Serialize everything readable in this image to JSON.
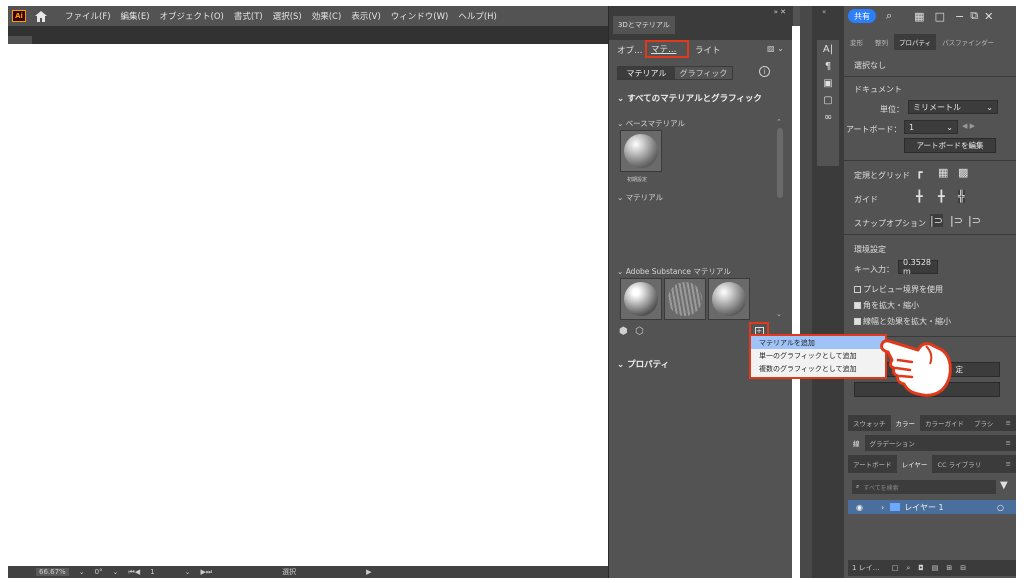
{
  "app": {
    "logo": "Ai"
  },
  "menubar": {
    "items": [
      "ファイル(F)",
      "編集(E)",
      "オブジェクト(O)",
      "書式(T)",
      "選択(S)",
      "効果(C)",
      "表示(V)",
      "ウィンドウ(W)",
      "ヘルプ(H)"
    ]
  },
  "topright": {
    "share": "共有",
    "icons": [
      "search-icon",
      "arrange-icon",
      "panel-icon",
      "minimize-icon",
      "restore-icon",
      "close-icon"
    ]
  },
  "panel3d": {
    "title": "3Dとマテリアル",
    "tabs": [
      "オブ…",
      "マテ…",
      "ライト"
    ],
    "segments": [
      "マテリアル",
      "グラフィック"
    ],
    "all_section": "すべてのマテリアルとグラフィック",
    "base_material": "ベースマテリアル",
    "default_label": "初期設定",
    "material_section": "マテリアル",
    "substance_section": "Adobe Substance マテリアル",
    "properties_section": "プロパティ"
  },
  "dropdown": {
    "items": [
      "マテリアルを追加",
      "単一のグラフィックとして追加",
      "複数のグラフィックとして追加"
    ]
  },
  "props": {
    "tabs": [
      "変形",
      "整列",
      "プロパティ",
      "パスファインダー"
    ],
    "no_selection": "選択なし",
    "document": "ドキュメント",
    "unit_label": "単位：",
    "unit_value": "ミリメートル",
    "artboard_label": "アートボード：",
    "artboard_value": "1",
    "edit_artboard": "アートボードを編集",
    "rulers_grid": "定規とグリッド",
    "guides": "ガイド",
    "snap_options": "スナップオプション",
    "preferences": "環境設定",
    "key_input_label": "キー入力：",
    "key_input_value": "0.3528 m",
    "preview_bounds": "プレビュー境界を使用",
    "scale_corners": "角を拡大・縮小",
    "scale_strokes": "線幅と効果を拡大・縮小",
    "button_partial": "定"
  },
  "layers": {
    "tabs1": [
      "スウォッチ",
      "カラー",
      "カラーガイド",
      "ブラシ"
    ],
    "tabs2": [
      "線",
      "グラデーション"
    ],
    "tabs3": [
      "アートボード",
      "レイヤー",
      "CC ライブラリ"
    ],
    "search_placeholder": "すべてを検索",
    "layer_name": "レイヤー 1",
    "footer_count": "1 レイ…"
  },
  "status": {
    "zoom": "66.67%",
    "rotation": "0°",
    "artboard": "1",
    "mode": "選択"
  },
  "colors": {
    "accent_red": "#e0391c",
    "share_blue": "#2d7ff9",
    "panel_bg": "#535353",
    "highlight": "#9fc3f7",
    "layer_row": "#4b6f9c"
  }
}
